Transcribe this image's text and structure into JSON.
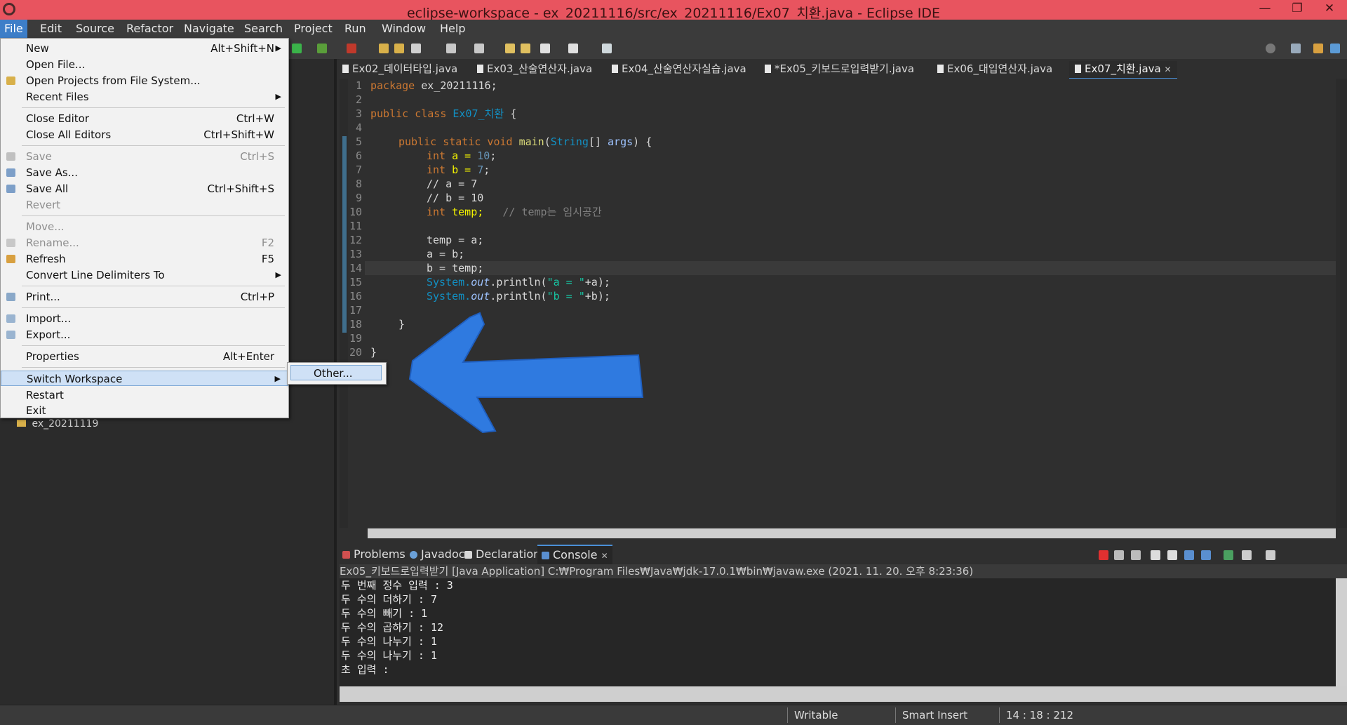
{
  "window": {
    "title": "eclipse-workspace - ex_20211116/src/ex_20211116/Ex07_치환.java - Eclipse IDE",
    "minimize": "—",
    "maximize": "❐",
    "close": "✕"
  },
  "menubar": [
    "File",
    "Edit",
    "Source",
    "Refactor",
    "Navigate",
    "Search",
    "Project",
    "Run",
    "Window",
    "Help"
  ],
  "editor_tabs": [
    {
      "label": "Ex02_데이터타입.java",
      "active": false
    },
    {
      "label": "Ex03_산술연산자.java",
      "active": false
    },
    {
      "label": "Ex04_산술연산자실습.java",
      "active": false
    },
    {
      "label": "*Ex05_키보드로입력받기.java",
      "active": false
    },
    {
      "label": "Ex06_대입연산자.java",
      "active": false
    },
    {
      "label": "Ex07_치환.java",
      "active": true
    }
  ],
  "editor_tab_close": "✕",
  "code_lines": [
    "1",
    "2",
    "3",
    "4",
    "5",
    "6",
    "7",
    "8",
    "9",
    "10",
    "11",
    "12",
    "13",
    "14",
    "15",
    "16",
    "17",
    "18",
    "19",
    "20"
  ],
  "code": {
    "l1_kw": "package",
    "l1_rest": " ex_20211116;",
    "l3_kw": "public class",
    "l3_name": " Ex07_치환",
    "l3_rest": " {",
    "l5_kw": "public static void",
    "l5_name": " main",
    "l5_paren": "(",
    "l5_type": "String",
    "l5_rest1": "[] ",
    "l5_args": "args",
    "l5_rest2": ") {",
    "l6_kw": "int",
    "l6_mid": " a = ",
    "l6_num": "10",
    "l6_end": ";",
    "l7_kw": "int",
    "l7_mid": " b = ",
    "l7_num": "7",
    "l7_end": ";",
    "l8": "// a = 7",
    "l9": "// b = 10",
    "l10_kw": "int",
    "l10_mid": " temp;",
    "l10_cm": "   // temp는 임시공간",
    "l12": "temp = a;",
    "l13": "a = b;",
    "l14": "b = temp;",
    "l15_sys": "System.",
    "l15_out": "out",
    "l15_mid": ".println(",
    "l15_str": "\"a = \"",
    "l15_end": "+a);",
    "l16_sys": "System.",
    "l16_out": "out",
    "l16_mid": ".println(",
    "l16_str": "\"b = \"",
    "l16_end": "+b);",
    "l18": "}",
    "l20": "}"
  },
  "bottom_tabs": [
    {
      "label": "Problems",
      "active": false
    },
    {
      "label": "Javadoc",
      "active": false
    },
    {
      "label": "Declaration",
      "active": false
    },
    {
      "label": "Console",
      "active": true
    }
  ],
  "console_header": "Ex05_키보드로입력받기 [Java Application] C:₩Program Files₩Java₩jdk-17.0.1₩bin₩javaw.exe  (2021. 11. 20. 오후 8:23:36)",
  "console_lines": [
    "두 번째 정수 입력 : 3",
    "두 수의 더하기 : 7",
    "두 수의 빼기 : 1",
    "두 수의 곱하기 : 12",
    "두 수의 나누기 : 1",
    "두 수의 나누기 : 1",
    "초 입력 :"
  ],
  "explorer": {
    "project": "ex_20211119"
  },
  "statusbar": {
    "mode": "Writable",
    "insert": "Smart Insert",
    "position": "14 : 18 : 212"
  },
  "file_menu": {
    "items": [
      {
        "label": "New",
        "accel": "Alt+Shift+N",
        "submenu": true
      },
      {
        "label": "Open File...",
        "accel": ""
      },
      {
        "label": "Open Projects from File System...",
        "accel": ""
      },
      {
        "label": "Recent Files",
        "accel": "",
        "submenu": true
      },
      {
        "label": "Close Editor",
        "accel": "Ctrl+W"
      },
      {
        "label": "Close All Editors",
        "accel": "Ctrl+Shift+W"
      },
      {
        "label": "Save",
        "accel": "Ctrl+S",
        "disabled": true
      },
      {
        "label": "Save As...",
        "accel": ""
      },
      {
        "label": "Save All",
        "accel": "Ctrl+Shift+S"
      },
      {
        "label": "Revert",
        "accel": "",
        "disabled": true
      },
      {
        "label": "Move...",
        "accel": "",
        "disabled": true
      },
      {
        "label": "Rename...",
        "accel": "F2",
        "disabled": true
      },
      {
        "label": "Refresh",
        "accel": "F5"
      },
      {
        "label": "Convert Line Delimiters To",
        "accel": "",
        "submenu": true
      },
      {
        "label": "Print...",
        "accel": "Ctrl+P"
      },
      {
        "label": "Import...",
        "accel": ""
      },
      {
        "label": "Export...",
        "accel": ""
      },
      {
        "label": "Properties",
        "accel": "Alt+Enter"
      },
      {
        "label": "Switch Workspace",
        "accel": "",
        "submenu": true,
        "highlighted": true
      },
      {
        "label": "Restart",
        "accel": ""
      },
      {
        "label": "Exit",
        "accel": ""
      }
    ],
    "submenu_item": "Other..."
  },
  "colors": {
    "titlebar": "#e8545f",
    "accent": "#4a8fd6",
    "annotation_arrow": "#2f7ae0"
  }
}
